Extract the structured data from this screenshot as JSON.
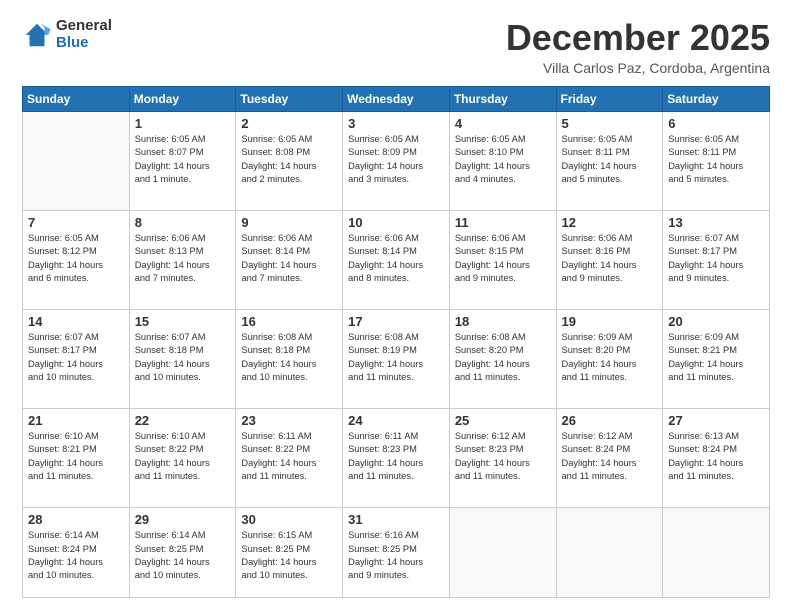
{
  "logo": {
    "general": "General",
    "blue": "Blue"
  },
  "title": "December 2025",
  "subtitle": "Villa Carlos Paz, Cordoba, Argentina",
  "weekdays": [
    "Sunday",
    "Monday",
    "Tuesday",
    "Wednesday",
    "Thursday",
    "Friday",
    "Saturday"
  ],
  "weeks": [
    [
      {
        "day": "",
        "info": ""
      },
      {
        "day": "1",
        "info": "Sunrise: 6:05 AM\nSunset: 8:07 PM\nDaylight: 14 hours\nand 1 minute."
      },
      {
        "day": "2",
        "info": "Sunrise: 6:05 AM\nSunset: 8:08 PM\nDaylight: 14 hours\nand 2 minutes."
      },
      {
        "day": "3",
        "info": "Sunrise: 6:05 AM\nSunset: 8:09 PM\nDaylight: 14 hours\nand 3 minutes."
      },
      {
        "day": "4",
        "info": "Sunrise: 6:05 AM\nSunset: 8:10 PM\nDaylight: 14 hours\nand 4 minutes."
      },
      {
        "day": "5",
        "info": "Sunrise: 6:05 AM\nSunset: 8:11 PM\nDaylight: 14 hours\nand 5 minutes."
      },
      {
        "day": "6",
        "info": "Sunrise: 6:05 AM\nSunset: 8:11 PM\nDaylight: 14 hours\nand 5 minutes."
      }
    ],
    [
      {
        "day": "7",
        "info": "Sunrise: 6:05 AM\nSunset: 8:12 PM\nDaylight: 14 hours\nand 6 minutes."
      },
      {
        "day": "8",
        "info": "Sunrise: 6:06 AM\nSunset: 8:13 PM\nDaylight: 14 hours\nand 7 minutes."
      },
      {
        "day": "9",
        "info": "Sunrise: 6:06 AM\nSunset: 8:14 PM\nDaylight: 14 hours\nand 7 minutes."
      },
      {
        "day": "10",
        "info": "Sunrise: 6:06 AM\nSunset: 8:14 PM\nDaylight: 14 hours\nand 8 minutes."
      },
      {
        "day": "11",
        "info": "Sunrise: 6:06 AM\nSunset: 8:15 PM\nDaylight: 14 hours\nand 9 minutes."
      },
      {
        "day": "12",
        "info": "Sunrise: 6:06 AM\nSunset: 8:16 PM\nDaylight: 14 hours\nand 9 minutes."
      },
      {
        "day": "13",
        "info": "Sunrise: 6:07 AM\nSunset: 8:17 PM\nDaylight: 14 hours\nand 9 minutes."
      }
    ],
    [
      {
        "day": "14",
        "info": "Sunrise: 6:07 AM\nSunset: 8:17 PM\nDaylight: 14 hours\nand 10 minutes."
      },
      {
        "day": "15",
        "info": "Sunrise: 6:07 AM\nSunset: 8:18 PM\nDaylight: 14 hours\nand 10 minutes."
      },
      {
        "day": "16",
        "info": "Sunrise: 6:08 AM\nSunset: 8:18 PM\nDaylight: 14 hours\nand 10 minutes."
      },
      {
        "day": "17",
        "info": "Sunrise: 6:08 AM\nSunset: 8:19 PM\nDaylight: 14 hours\nand 11 minutes."
      },
      {
        "day": "18",
        "info": "Sunrise: 6:08 AM\nSunset: 8:20 PM\nDaylight: 14 hours\nand 11 minutes."
      },
      {
        "day": "19",
        "info": "Sunrise: 6:09 AM\nSunset: 8:20 PM\nDaylight: 14 hours\nand 11 minutes."
      },
      {
        "day": "20",
        "info": "Sunrise: 6:09 AM\nSunset: 8:21 PM\nDaylight: 14 hours\nand 11 minutes."
      }
    ],
    [
      {
        "day": "21",
        "info": "Sunrise: 6:10 AM\nSunset: 8:21 PM\nDaylight: 14 hours\nand 11 minutes."
      },
      {
        "day": "22",
        "info": "Sunrise: 6:10 AM\nSunset: 8:22 PM\nDaylight: 14 hours\nand 11 minutes."
      },
      {
        "day": "23",
        "info": "Sunrise: 6:11 AM\nSunset: 8:22 PM\nDaylight: 14 hours\nand 11 minutes."
      },
      {
        "day": "24",
        "info": "Sunrise: 6:11 AM\nSunset: 8:23 PM\nDaylight: 14 hours\nand 11 minutes."
      },
      {
        "day": "25",
        "info": "Sunrise: 6:12 AM\nSunset: 8:23 PM\nDaylight: 14 hours\nand 11 minutes."
      },
      {
        "day": "26",
        "info": "Sunrise: 6:12 AM\nSunset: 8:24 PM\nDaylight: 14 hours\nand 11 minutes."
      },
      {
        "day": "27",
        "info": "Sunrise: 6:13 AM\nSunset: 8:24 PM\nDaylight: 14 hours\nand 11 minutes."
      }
    ],
    [
      {
        "day": "28",
        "info": "Sunrise: 6:14 AM\nSunset: 8:24 PM\nDaylight: 14 hours\nand 10 minutes."
      },
      {
        "day": "29",
        "info": "Sunrise: 6:14 AM\nSunset: 8:25 PM\nDaylight: 14 hours\nand 10 minutes."
      },
      {
        "day": "30",
        "info": "Sunrise: 6:15 AM\nSunset: 8:25 PM\nDaylight: 14 hours\nand 10 minutes."
      },
      {
        "day": "31",
        "info": "Sunrise: 6:16 AM\nSunset: 8:25 PM\nDaylight: 14 hours\nand 9 minutes."
      },
      {
        "day": "",
        "info": ""
      },
      {
        "day": "",
        "info": ""
      },
      {
        "day": "",
        "info": ""
      }
    ]
  ]
}
